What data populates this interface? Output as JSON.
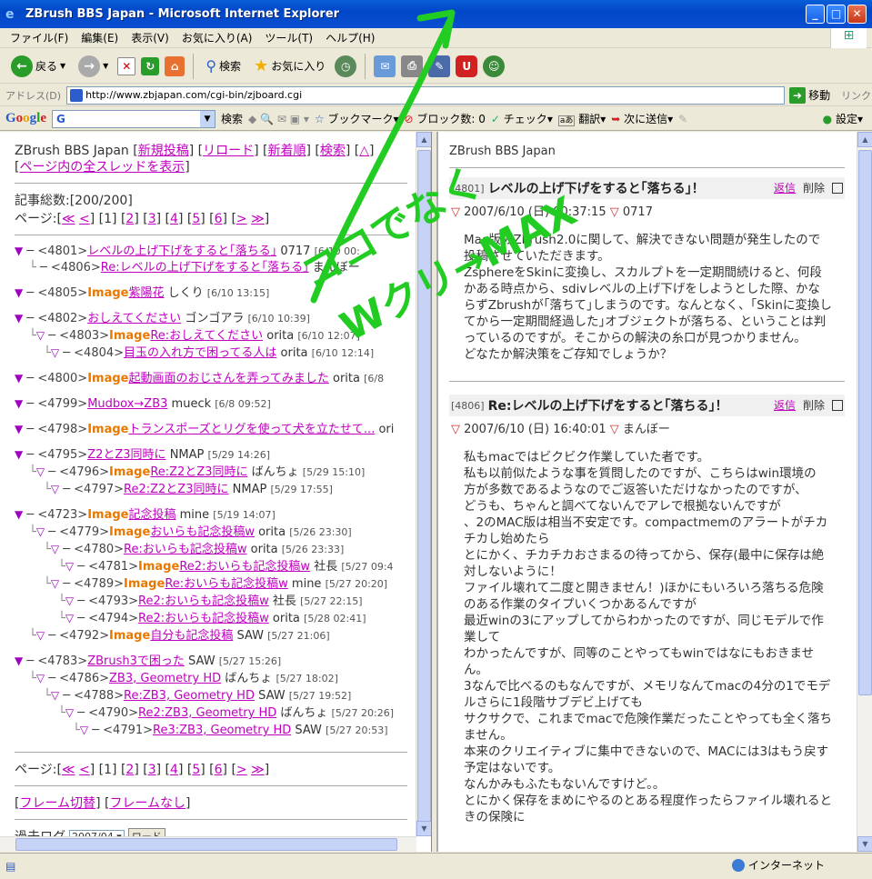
{
  "window": {
    "title": "ZBrush BBS Japan - Microsoft Internet Explorer",
    "buttons": [
      "_",
      "□",
      "X"
    ]
  },
  "menu": [
    "ファイル(F)",
    "編集(E)",
    "表示(V)",
    "お気に入り(A)",
    "ツール(T)",
    "ヘルプ(H)"
  ],
  "toolbar": {
    "back": "戻る",
    "search": "検索",
    "favorites": "お気に入り"
  },
  "address": {
    "label": "アドレス(D)",
    "url": "http://www.zbjapan.com/cgi-bin/zjboard.cgi",
    "go": "移動",
    "links": "リンク"
  },
  "googlebar": {
    "logo": "Google",
    "search_value": "G",
    "search_btn": "検索",
    "bookmarks": "ブックマーク",
    "block": "ブロック数: 0",
    "check": "チェック",
    "translate": "翻訳",
    "send": "次に送信",
    "settings": "設定"
  },
  "left": {
    "board_name": "ZBrush BBS Japan",
    "links": [
      "新規投稿",
      "リロード",
      "新着順",
      "検索",
      "△"
    ],
    "show_all": "ページ内の全スレッドを表示",
    "total": "記事総数:[200/200]",
    "pager_label": "ページ:",
    "pager": [
      "≪",
      "<",
      "1",
      "2",
      "3",
      "4",
      "5",
      "6",
      ">",
      "≫"
    ],
    "threads": [
      {
        "lvl": 0,
        "icon": "filled",
        "no": "<4801>",
        "img": "",
        "title": "レベルの上げ下げをすると｢落ちる｣",
        "author": "0717",
        "date": "[6/10 00:"
      },
      {
        "lvl": 1,
        "icon": "none",
        "no": "<4806>",
        "img": "",
        "title": "Re:レベルの上げ下げをすると｢落ちる｣",
        "author": "まんぼー",
        "date": ""
      },
      {
        "lvl": 0,
        "icon": "filled",
        "no": "<4805>",
        "img": "Image",
        "title": "紫陽花",
        "author": "しくり",
        "date": "[6/10 13:15]"
      },
      {
        "lvl": 0,
        "icon": "filled",
        "no": "<4802>",
        "img": "",
        "title": "おしえてください",
        "author": "ゴンゴアラ",
        "date": "[6/10 10:39]"
      },
      {
        "lvl": 1,
        "icon": "open",
        "no": "<4803>",
        "img": "Image",
        "title": "Re:おしえてください",
        "author": "orita",
        "date": "[6/10 12:07]"
      },
      {
        "lvl": 2,
        "icon": "open",
        "no": "<4804>",
        "img": "",
        "title": "目玉の入れ方で困ってる人は",
        "author": "orita",
        "date": "[6/10 12:14]"
      },
      {
        "lvl": 0,
        "icon": "filled",
        "no": "<4800>",
        "img": "Image",
        "title": "起動画面のおじさんを弄ってみました",
        "author": "orita",
        "date": "[6/8"
      },
      {
        "lvl": 0,
        "icon": "filled",
        "no": "<4799>",
        "img": "",
        "title": "Mudbox→ZB3",
        "author": "mueck",
        "date": "[6/8 09:52]"
      },
      {
        "lvl": 0,
        "icon": "filled",
        "no": "<4798>",
        "img": "Image",
        "title": "トランスポーズとリグを使って犬を立たせて...",
        "author": "ori",
        "date": ""
      },
      {
        "lvl": 0,
        "icon": "filled",
        "no": "<4795>",
        "img": "",
        "title": "Z2とZ3同時に",
        "author": "NMAP",
        "date": "[5/29 14:26]"
      },
      {
        "lvl": 1,
        "icon": "open",
        "no": "<4796>",
        "img": "Image",
        "title": "Re:Z2とZ3同時に",
        "author": "ばんちょ",
        "date": "[5/29 15:10]"
      },
      {
        "lvl": 2,
        "icon": "open",
        "no": "<4797>",
        "img": "",
        "title": "Re2:Z2とZ3同時に",
        "author": "NMAP",
        "date": "[5/29 17:55]"
      },
      {
        "lvl": 0,
        "icon": "filled",
        "no": "<4723>",
        "img": "Image",
        "title": "記念投稿",
        "author": "mine",
        "date": "[5/19 14:07]"
      },
      {
        "lvl": 1,
        "icon": "open",
        "no": "<4779>",
        "img": "Image",
        "title": "おいらも記念投稿w",
        "author": "orita",
        "date": "[5/26 23:30]"
      },
      {
        "lvl": 2,
        "icon": "open",
        "no": "<4780>",
        "img": "",
        "title": "Re:おいらも記念投稿w",
        "author": "orita",
        "date": "[5/26 23:33]"
      },
      {
        "lvl": 3,
        "icon": "open",
        "no": "<4781>",
        "img": "Image",
        "title": "Re2:おいらも記念投稿w",
        "author": "社長",
        "date": "[5/27 09:4"
      },
      {
        "lvl": 2,
        "icon": "open",
        "no": "<4789>",
        "img": "Image",
        "title": "Re:おいらも記念投稿w",
        "author": "mine",
        "date": "[5/27 20:20]"
      },
      {
        "lvl": 3,
        "icon": "open",
        "no": "<4793>",
        "img": "",
        "title": "Re2:おいらも記念投稿w",
        "author": "社長",
        "date": "[5/27 22:15]"
      },
      {
        "lvl": 3,
        "icon": "open",
        "no": "<4794>",
        "img": "",
        "title": "Re2:おいらも記念投稿w",
        "author": "orita",
        "date": "[5/28 02:41]"
      },
      {
        "lvl": 1,
        "icon": "open",
        "no": "<4792>",
        "img": "Image",
        "title": "自分も記念投稿",
        "author": "SAW",
        "date": "[5/27 21:06]"
      },
      {
        "lvl": 0,
        "icon": "filled",
        "no": "<4783>",
        "img": "",
        "title": "ZBrush3で困った",
        "author": "SAW",
        "date": "[5/27 15:26]"
      },
      {
        "lvl": 1,
        "icon": "open",
        "no": "<4786>",
        "img": "",
        "title": "ZB3, Geometry HD",
        "author": "ばんちょ",
        "date": "[5/27 18:02]"
      },
      {
        "lvl": 2,
        "icon": "open",
        "no": "<4788>",
        "img": "",
        "title": "Re:ZB3, Geometry HD",
        "author": "SAW",
        "date": "[5/27 19:52]"
      },
      {
        "lvl": 3,
        "icon": "open",
        "no": "<4790>",
        "img": "",
        "title": "Re2:ZB3, Geometry HD",
        "author": "ばんちょ",
        "date": "[5/27 20:26]"
      },
      {
        "lvl": 4,
        "icon": "open",
        "no": "<4791>",
        "img": "",
        "title": "Re3:ZB3, Geometry HD",
        "author": "SAW",
        "date": "[5/27 20:53]"
      }
    ],
    "frame_links": [
      "フレーム切替",
      "フレームなし"
    ],
    "archive_label": "過去ログ",
    "archive_value": "2007/04",
    "archive_btn": "ロード"
  },
  "right": {
    "board_name": "ZBrush BBS Japan",
    "reply": "返信",
    "delete": "削除",
    "posts": [
      {
        "no": "[4801]",
        "title": "レベルの上げ下げをすると｢落ちる｣！",
        "date": "2007/6/10 (日) 00:37:15",
        "author": "0717",
        "body": [
          "Mac版のZbrush2.0に関して、解決できない問題が発生したので投稿させていただきます。",
          "ZsphereをSkinに変換し、スカルプトを一定期間続けると、何段かある時点から、sdivレベルの上げ下げをしようとした際、かならずZbrushが｢落ちて｣しまうのです。なんとなく、｢Skinに変換してから一定期間経過した｣オブジェクトが落ちる、ということは判っているのですが。そこからの解決の糸口が見つかりません。",
          "どなたか解決策をご存知でしょうか？"
        ]
      },
      {
        "no": "[4806]",
        "title": "Re:レベルの上げ下げをすると｢落ちる｣！",
        "date": "2007/6/10 (日) 16:40:01",
        "author": "まんぼー",
        "body": [
          "私もmacではビクビク作業していた者です。",
          "私も以前似たような事を質問したのですが、こちらはwin環境の",
          "方が多数であるようなのでご返答いただけなかったのですが、",
          "どうも、ちゃんと調べてないんでアレで根拠ないんですが",
          "、2のMAC版は相当不安定です。compactmemのアラートがチカチカし始めたら",
          "とにかく、チカチカおさまるの待ってから、保存(最中に保存は絶対しないように！",
          "ファイル壊れて二度と開きません！)ほかにもいろいろ落ちる危険のある作業のタイプいくつかあるんですが",
          "最近winの3にアップしてからわかったのですが、同じモデルで作業して",
          "わかったんですが、同等のことやってもwinではなにもおきません。",
          "3なんで比べるのもなんですが、メモリなんてmacの4分の1でモデルさらに1段階サブデビ上げても",
          "サクサクで、これまでmacで危険作業だったことやっても全く落ちません。",
          "本来のクリエイティブに集中できないので、MACには3はもう戻す予定はないです。",
          "なんかみもふたもないんですけど。。",
          "とにかく保存をまめにやるのとある程度作ったらファイル壊れるときの保険に"
        ]
      }
    ]
  },
  "status": {
    "zone": "インターネット"
  },
  "annotation": {
    "line1": "ココでなく",
    "line2": "Wクリ→MAX",
    "color": "#22cc22"
  }
}
